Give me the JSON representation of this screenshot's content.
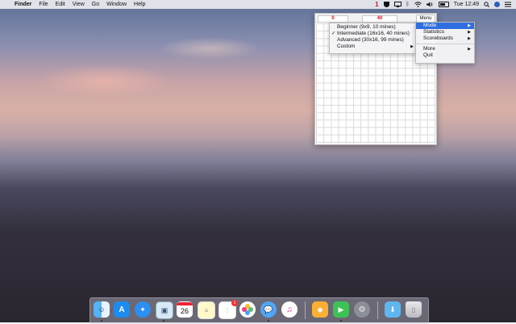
{
  "menubar": {
    "apple_glyph": "",
    "app_name": "Finder",
    "items": [
      "File",
      "Edit",
      "View",
      "Go",
      "Window",
      "Help"
    ],
    "tray": {
      "mines_badge": "1",
      "clock": "Tue 12:49",
      "icons": [
        "minesweeper-icon",
        "shield-icon",
        "airplay-icon",
        "bluetooth-icon",
        "wifi-icon",
        "volume-icon",
        "battery-icon",
        "search-icon",
        "siri-icon",
        "notification-icon"
      ]
    }
  },
  "minesweeper": {
    "mine_counter": "0",
    "timer": "40",
    "menu_button": "Menu"
  },
  "mode_submenu": {
    "items": [
      {
        "label": "Beginner (9x9, 10 mines)",
        "checked": false
      },
      {
        "label": "Intermediate (16x16, 40 mines)",
        "checked": true
      },
      {
        "label": "Advanced (30x16, 99 mines)",
        "checked": false
      },
      {
        "label": "Custom",
        "checked": false
      }
    ],
    "check_glyph": "✓",
    "arrow_glyph": "▶"
  },
  "main_menu": {
    "items": [
      {
        "label": "Mode",
        "selected": true
      },
      {
        "label": "Statistics",
        "selected": false
      },
      {
        "label": "Scoreboards",
        "selected": false
      },
      {
        "label": "More",
        "selected": false
      },
      {
        "label": "Quit",
        "selected": false
      }
    ],
    "arrow_glyph": "▶"
  },
  "dock": {
    "calendar_day": "26",
    "reminders_badge": "1",
    "apps": [
      "finder-icon",
      "app-store-icon",
      "safari-icon",
      "preview-icon",
      "calendar-icon",
      "notes-icon",
      "reminders-icon",
      "photos-icon",
      "messages-icon",
      "itunes-icon",
      "sketch-icon",
      "facetime-icon",
      "system-preferences-icon",
      "downloads-folder-icon",
      "trash-icon"
    ]
  }
}
